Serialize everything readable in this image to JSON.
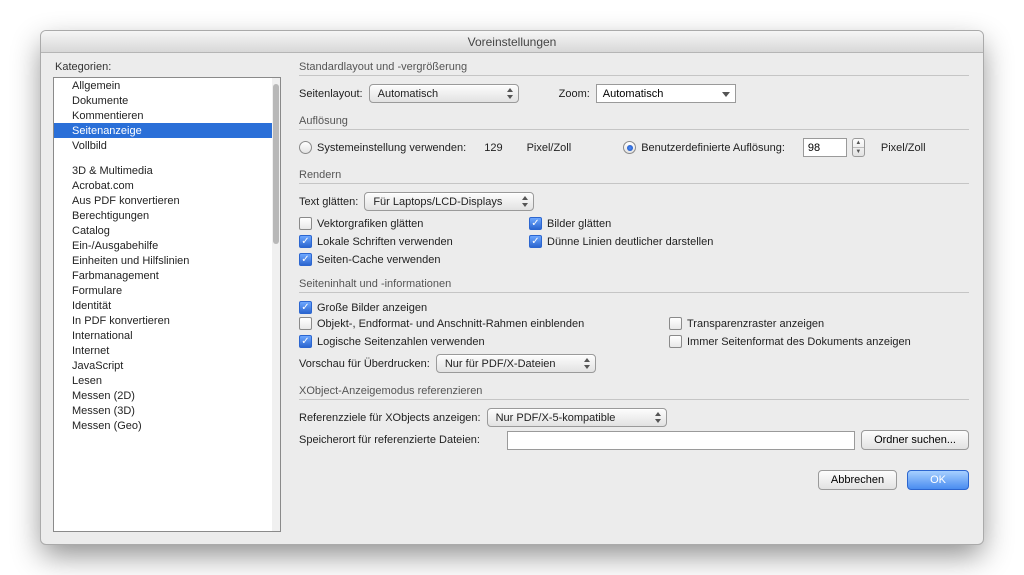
{
  "title": "Voreinstellungen",
  "sidebar": {
    "label": "Kategorien:",
    "group1": [
      "Allgemein",
      "Dokumente",
      "Kommentieren",
      "Seitenanzeige",
      "Vollbild"
    ],
    "group2": [
      "3D & Multimedia",
      "Acrobat.com",
      "Aus PDF konvertieren",
      "Berechtigungen",
      "Catalog",
      "Ein-/Ausgabehilfe",
      "Einheiten und Hilfslinien",
      "Farbmanagement",
      "Formulare",
      "Identität",
      "In PDF konvertieren",
      "International",
      "Internet",
      "JavaScript",
      "Lesen",
      "Messen (2D)",
      "Messen (3D)",
      "Messen (Geo)"
    ],
    "selected": "Seitenanzeige"
  },
  "layout": {
    "heading": "Standardlayout und -vergrößerung",
    "page_layout_label": "Seitenlayout:",
    "page_layout_value": "Automatisch",
    "zoom_label": "Zoom:",
    "zoom_value": "Automatisch"
  },
  "resolution": {
    "heading": "Auflösung",
    "system_label": "Systemeinstellung verwenden:",
    "system_value": "129",
    "unit": "Pixel/Zoll",
    "custom_label": "Benutzerdefinierte Auflösung:",
    "custom_value": "98"
  },
  "render": {
    "heading": "Rendern",
    "smooth_text_label": "Text glätten:",
    "smooth_text_value": "Für Laptops/LCD-Displays",
    "vector": "Vektorgrafiken glätten",
    "images": "Bilder glätten",
    "local_fonts": "Lokale Schriften verwenden",
    "thin_lines": "Dünne Linien deutlicher darstellen",
    "page_cache": "Seiten-Cache verwenden"
  },
  "content": {
    "heading": "Seiteninhalt und -informationen",
    "big_images": "Große Bilder anzeigen",
    "boxes": "Objekt-, Endformat- und Anschnitt-Rahmen einblenden",
    "transparency": "Transparenzraster anzeigen",
    "logical_pages": "Logische Seitenzahlen verwenden",
    "always_format": "Immer Seitenformat des Dokuments anzeigen",
    "overprint_label": "Vorschau für Überdrucken:",
    "overprint_value": "Nur für PDF/X-Dateien"
  },
  "xobject": {
    "heading": "XObject-Anzeigemodus referenzieren",
    "targets_label": "Referenzziele für XObjects anzeigen:",
    "targets_value": "Nur PDF/X-5-kompatible",
    "location_label": "Speicherort für referenzierte Dateien:",
    "browse": "Ordner suchen..."
  },
  "buttons": {
    "cancel": "Abbrechen",
    "ok": "OK"
  }
}
